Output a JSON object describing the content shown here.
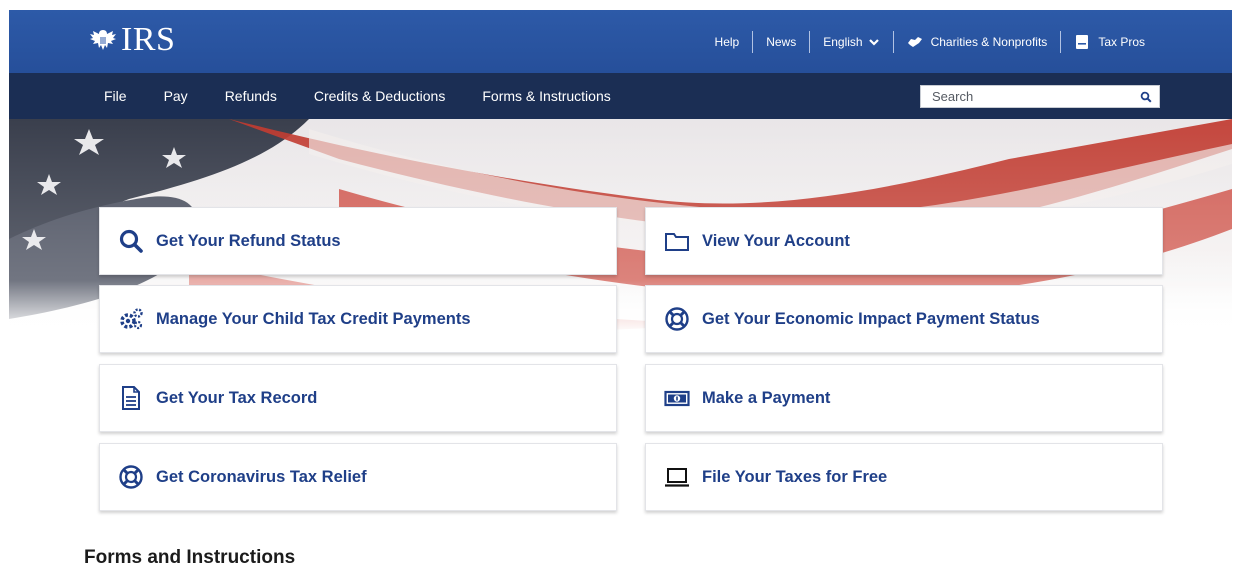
{
  "header": {
    "logo_text": "IRS",
    "utility": {
      "help": "Help",
      "news": "News",
      "language": "English",
      "charities": "Charities & Nonprofits",
      "tax_pros": "Tax Pros"
    }
  },
  "nav": {
    "items": [
      "File",
      "Pay",
      "Refunds",
      "Credits & Deductions",
      "Forms & Instructions"
    ],
    "search_placeholder": "Search"
  },
  "cards": [
    {
      "label": "Get Your Refund Status",
      "icon": "search-icon"
    },
    {
      "label": "View Your Account",
      "icon": "folder-icon"
    },
    {
      "label": "Manage Your Child Tax Credit Payments",
      "icon": "gears-icon"
    },
    {
      "label": "Get Your Economic Impact Payment Status",
      "icon": "lifebuoy-icon"
    },
    {
      "label": "Get Your Tax Record",
      "icon": "document-icon"
    },
    {
      "label": "Make a Payment",
      "icon": "money-icon"
    },
    {
      "label": "Get Coronavirus Tax Relief",
      "icon": "lifebuoy-icon"
    },
    {
      "label": "File Your Taxes for Free",
      "icon": "laptop-icon"
    }
  ],
  "sections": {
    "forms_title": "Forms and Instructions"
  },
  "colors": {
    "header_blue": "#2d5aa8",
    "nav_navy": "#1b2e54",
    "link_blue": "#1f3f88"
  }
}
